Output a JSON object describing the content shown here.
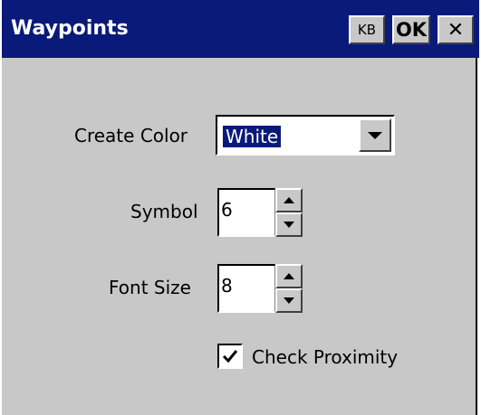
{
  "window": {
    "title": "Waypoints",
    "buttons": {
      "kb_label": "KB",
      "ok_label": "OK",
      "close_label": "✕"
    }
  },
  "form": {
    "create_color": {
      "label": "Create Color",
      "value": "White"
    },
    "symbol": {
      "label": "Symbol",
      "value": "6"
    },
    "font_size": {
      "label": "Font Size",
      "value": "8"
    },
    "check_proximity": {
      "label": "Check Proximity",
      "checked": true
    }
  },
  "colors": {
    "title_bar": "#0a1a7a",
    "title_text": "#ffffff",
    "window_bg": "#c8c8c8",
    "selection_bg": "#0a1a7a"
  },
  "icons": {
    "dropdown": "triangle-down-icon",
    "spin_up": "triangle-up-icon",
    "spin_down": "triangle-down-icon",
    "check": "checkmark-icon",
    "close": "close-icon"
  }
}
